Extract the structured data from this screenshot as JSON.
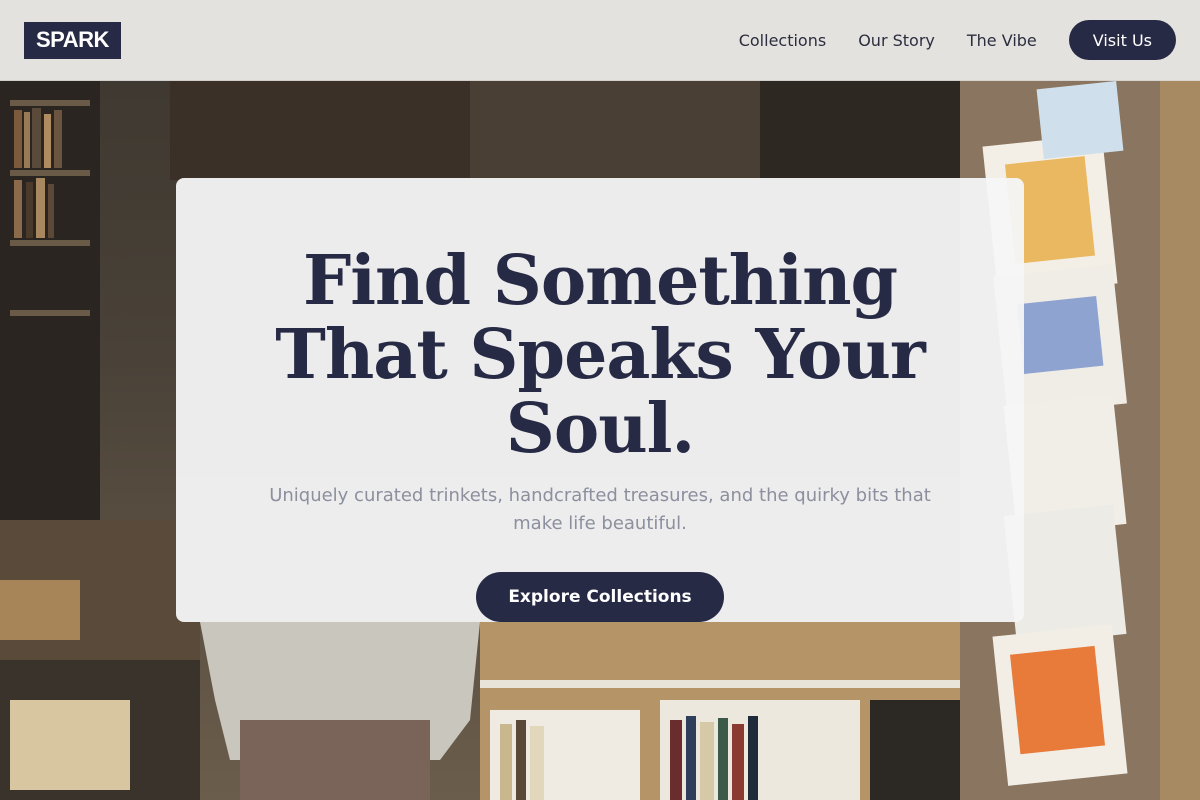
{
  "brand": {
    "logo_text": "SPARK"
  },
  "nav": {
    "links": [
      "Collections",
      "Our Story",
      "The Vibe"
    ],
    "cta_label": "Visit Us"
  },
  "hero": {
    "title": "Find Something That Speaks Your Soul.",
    "subtitle": "Uniquely curated trinkets, handcrafted treasures, and the quirky bits that make life beautiful.",
    "cta_label": "Explore Collections"
  },
  "colors": {
    "brand_navy": "#272a45",
    "subtitle_gray": "#8c8f9e",
    "header_bg": "#f0efec",
    "card_bg": "#f6f6f7"
  }
}
